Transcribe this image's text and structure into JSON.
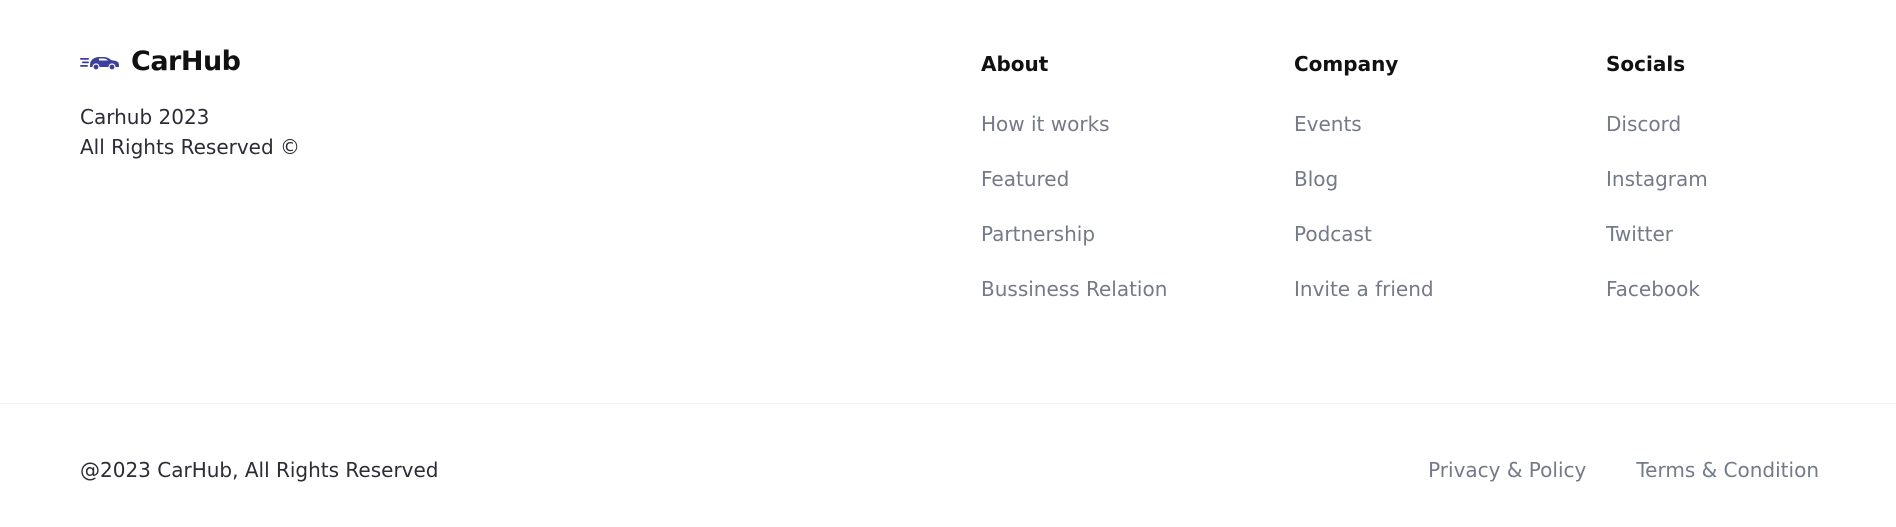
{
  "brand": {
    "name": "CarHub",
    "logo_icon": "car-speed-icon",
    "copyright_line1": "Carhub 2023",
    "copyright_line2": "All Rights Reserved ©"
  },
  "columns": [
    {
      "title": "About",
      "links": [
        "How it works",
        "Featured",
        "Partnership",
        "Bussiness Relation"
      ]
    },
    {
      "title": "Company",
      "links": [
        "Events",
        "Blog",
        "Podcast",
        "Invite a friend"
      ]
    },
    {
      "title": "Socials",
      "links": [
        "Discord",
        "Instagram",
        "Twitter",
        "Facebook"
      ]
    }
  ],
  "bottom": {
    "copyright": "@2023 CarHub, All Rights Reserved",
    "links": [
      "Privacy & Policy",
      "Terms & Condition"
    ]
  },
  "colors": {
    "logo_accent": "#3d3f9e",
    "heading": "#111111",
    "body_text": "#2b2c35",
    "link_text": "#747a88",
    "divider": "#f1f2f4"
  }
}
